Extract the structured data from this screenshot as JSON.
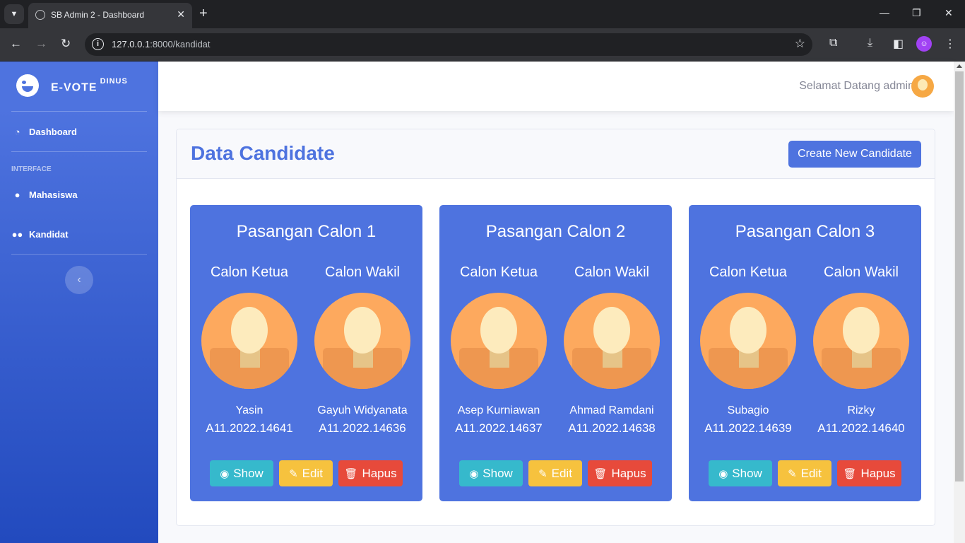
{
  "browser": {
    "tab_title": "SB Admin 2 - Dashboard",
    "url_host": "127.0.0.1",
    "url_rest": ":8000/kandidat"
  },
  "sidebar": {
    "brand": "E-VOTE",
    "brand_sup": "DINUS",
    "items": [
      {
        "label": "Dashboard",
        "icon": "tachometer-icon"
      },
      {
        "label": "Mahasiswa",
        "icon": "user-icon"
      },
      {
        "label": "Kandidat",
        "icon": "users-icon"
      }
    ],
    "heading": "INTERFACE"
  },
  "topbar": {
    "welcome": "Selamat Datang admin"
  },
  "page": {
    "title": "Data Candidate",
    "create_button": "Create New Candidate"
  },
  "roles": {
    "ketua": "Calon Ketua",
    "wakil": "Calon Wakil"
  },
  "buttons": {
    "show": "Show",
    "edit": "Edit",
    "hapus": "Hapus"
  },
  "candidates": [
    {
      "title": "Pasangan Calon 1",
      "ketua": {
        "name": "Yasin",
        "nim": "A11.2022.14641"
      },
      "wakil": {
        "name": "Gayuh Widyanata",
        "nim": "A11.2022.14636"
      }
    },
    {
      "title": "Pasangan Calon 2",
      "ketua": {
        "name": "Asep Kurniawan",
        "nim": "A11.2022.14637"
      },
      "wakil": {
        "name": "Ahmad Ramdani",
        "nim": "A11.2022.14638"
      }
    },
    {
      "title": "Pasangan Calon 3",
      "ketua": {
        "name": "Subagio",
        "nim": "A11.2022.14639"
      },
      "wakil": {
        "name": "Rizky",
        "nim": "A11.2022.14640"
      }
    }
  ],
  "colors": {
    "primary": "#4e73df",
    "info": "#36b9cc",
    "warning": "#f6c23e",
    "danger": "#e74a3b"
  }
}
